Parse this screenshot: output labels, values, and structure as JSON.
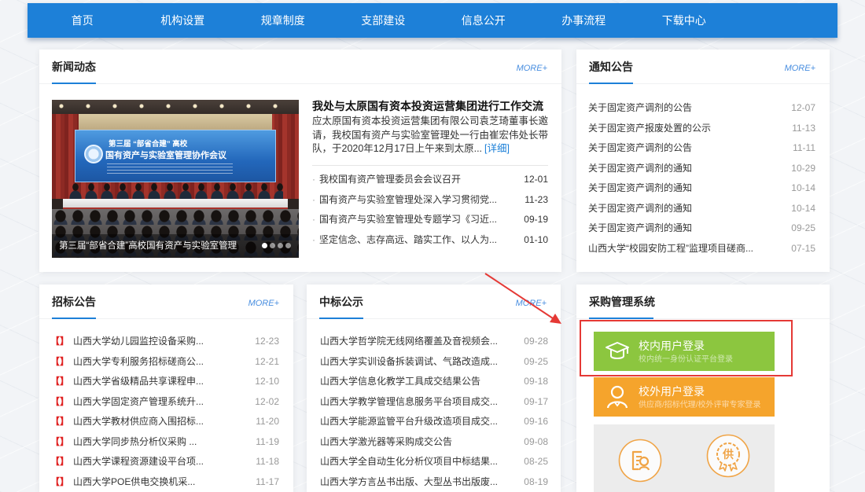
{
  "colors": {
    "nav_blue": "#1d80d8",
    "accent_blue": "#1d80d8",
    "more_link_blue": "#4a8fe0",
    "marker_red": "#e02020",
    "internal_login_green": "#8cc63f",
    "external_login_orange": "#f5a42c",
    "annotation_red": "#e53935"
  },
  "nav": {
    "items": [
      "首页",
      "机构设置",
      "规章制度",
      "支部建设",
      "信息公开",
      "办事流程",
      "下载中心"
    ]
  },
  "news": {
    "title": "新闻动态",
    "more": "MORE+",
    "bullet": "·",
    "slide": {
      "banner_line1": "第三届 “部省合建” 高校",
      "banner_line2": "国有资产与实验室管理协作会议",
      "caption": "第三届“部省合建”高校国有资产与实验室管理",
      "indicators": [
        {
          "active": true
        },
        {
          "active": false
        },
        {
          "active": false
        },
        {
          "active": false
        }
      ]
    },
    "featured": {
      "headline": "我处与太原国有资本投资运营集团进行工作交流",
      "summary": "应太原国有资本投资运营集团有限公司袁芝琦董事长邀请，我校国有资产与实验室管理处一行由崔宏伟处长带队，于2020年12月17日上午来到太原...",
      "detail_link": "[详细]"
    },
    "items": [
      {
        "title": "我校国有资产管理委员会会议召开",
        "date": "12-01"
      },
      {
        "title": "国有资产与实验室管理处深入学习贯彻党...",
        "date": "11-23"
      },
      {
        "title": "国有资产与实验室管理处专题学习《习近...",
        "date": "09-19"
      },
      {
        "title": "坚定信念、志存高远、踏实工作、以人为...",
        "date": "01-10"
      }
    ]
  },
  "notices": {
    "title": "通知公告",
    "more": "MORE+",
    "items": [
      {
        "title": "关于固定资产调剂的公告",
        "date": "12-07"
      },
      {
        "title": "关于固定资产报废处置的公示",
        "date": "11-13"
      },
      {
        "title": "关于固定资产调剂的公告",
        "date": "11-11"
      },
      {
        "title": "关于固定资产调剂的通知",
        "date": "10-29"
      },
      {
        "title": "关于固定资产调剂的通知",
        "date": "10-14"
      },
      {
        "title": "关于固定资产调剂的通知",
        "date": "10-14"
      },
      {
        "title": "关于固定资产调剂的通知",
        "date": "09-25"
      },
      {
        "title": "山西大学“校园安防工程”监理项目磋商...",
        "date": "07-15"
      }
    ]
  },
  "tenders": {
    "title": "招标公告",
    "more": "MORE+",
    "marker": "【】",
    "items": [
      {
        "title": "山西大学幼儿园监控设备采购...",
        "date": "12-23"
      },
      {
        "title": "山西大学专利服务招标磋商公...",
        "date": "12-21"
      },
      {
        "title": "山西大学省级精品共享课程申...",
        "date": "12-10"
      },
      {
        "title": "山西大学固定资产管理系统升...",
        "date": "12-02"
      },
      {
        "title": "山西大学教材供应商入围招标...",
        "date": "11-20"
      },
      {
        "title": "山西大学同步热分析仪采购 ...",
        "date": "11-19"
      },
      {
        "title": "山西大学课程资源建设平台项...",
        "date": "11-18"
      },
      {
        "title": "山西大学POE供电交换机采...",
        "date": "11-17"
      }
    ]
  },
  "awards": {
    "title": "中标公示",
    "more": "MORE+",
    "items": [
      {
        "title": "山西大学哲学院无线网络覆盖及音视频会...",
        "date": "09-28"
      },
      {
        "title": "山西大学实训设备拆装调试、气路改造成...",
        "date": "09-25"
      },
      {
        "title": "山西大学信息化教学工具成交结果公告",
        "date": "09-18"
      },
      {
        "title": "山西大学教学管理信息服务平台项目成交...",
        "date": "09-17"
      },
      {
        "title": "山西大学能源监管平台升级改造项目成交...",
        "date": "09-16"
      },
      {
        "title": "山西大学激光器等采购成交公告",
        "date": "09-08"
      },
      {
        "title": "山西大学全自动生化分析仪项目中标结果...",
        "date": "08-25"
      },
      {
        "title": "山西大学方言丛书出版、大型丛书出版废...",
        "date": "08-19"
      }
    ]
  },
  "procurement": {
    "title": "采购管理系统",
    "internal_login": {
      "title": "校内用户登录",
      "subtitle": "校内统一身份认证平台登录",
      "icon": "graduation-cap-icon"
    },
    "external_login": {
      "title": "校外用户登录",
      "subtitle": "供应商/招标代理/校外评审专家登录",
      "icon": "person-icon"
    },
    "shortcuts": [
      {
        "icon": "document-search-icon"
      },
      {
        "icon": "supplier-seal-icon",
        "glyph": "供"
      }
    ]
  }
}
